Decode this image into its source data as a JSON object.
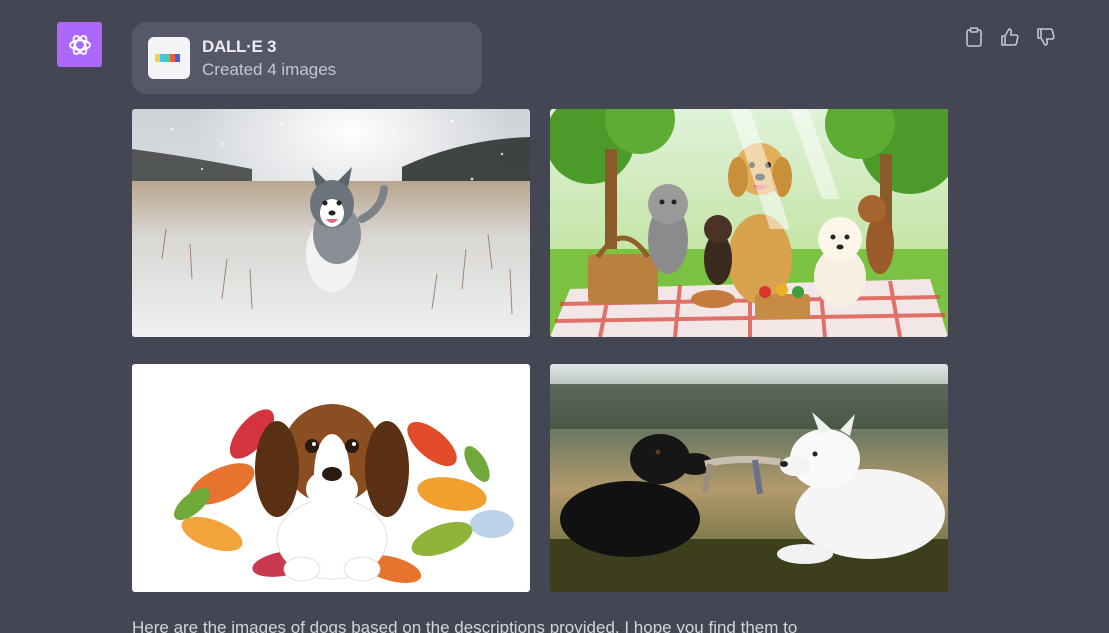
{
  "tool": {
    "name": "DALL·E 3",
    "status": "Created 4 images"
  },
  "actions": {
    "copy_icon": "clipboard-icon",
    "like_icon": "thumbs-up-icon",
    "dislike_icon": "thumbs-down-icon"
  },
  "images": [
    {
      "subject": "husky-snow"
    },
    {
      "subject": "dogs-picnic"
    },
    {
      "subject": "beagle-autumn-leaves"
    },
    {
      "subject": "dogs-tug-of-war"
    }
  ],
  "message": {
    "text": "Here are the images of dogs based on the descriptions provided. I hope you find them to"
  },
  "colors": {
    "background": "#444654",
    "avatar": "#ab68ff",
    "card": "#565869"
  }
}
